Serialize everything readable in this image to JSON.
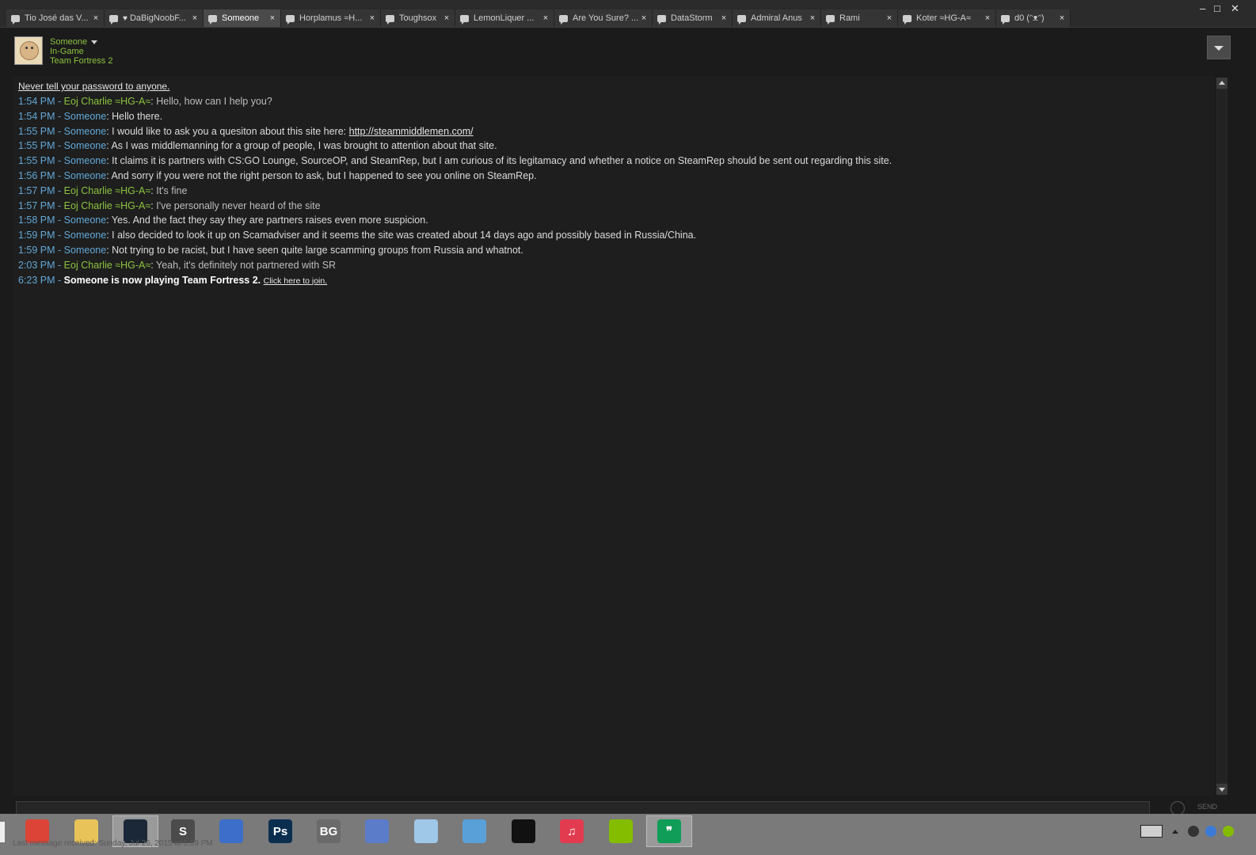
{
  "tabs": [
    {
      "label": "Tio José das V...",
      "heart": false,
      "active": false
    },
    {
      "label": "DaBigNoobF...",
      "heart": true,
      "active": false
    },
    {
      "label": "Someone",
      "heart": false,
      "active": true
    },
    {
      "label": "Horplamus ≈H...",
      "heart": false,
      "active": false
    },
    {
      "label": "Toughsox",
      "heart": false,
      "active": false
    },
    {
      "label": "LemonLiquer ...",
      "heart": false,
      "active": false
    },
    {
      "label": "Are You Sure? ...",
      "heart": false,
      "active": false
    },
    {
      "label": "DataStorm",
      "heart": false,
      "active": false
    },
    {
      "label": "Admiral Anus",
      "heart": false,
      "active": false
    },
    {
      "label": "Rami",
      "heart": false,
      "active": false
    },
    {
      "label": "Koter ≈HG-A≈",
      "heart": false,
      "active": false
    },
    {
      "label": "d0 (ᵔᴥᵔ)",
      "heart": false,
      "active": false
    }
  ],
  "tab_close": "×",
  "window_controls": {
    "minimize": "–",
    "maximize": "□",
    "close": "✕"
  },
  "header": {
    "name": "Someone",
    "status": "In-Game",
    "game": "Team Fortress 2"
  },
  "chat": {
    "warning": "Never tell your password to anyone.",
    "messages": [
      {
        "time": "1:54 PM",
        "sender": "Eoj Charlie ≈HG-A≈",
        "from_me": false,
        "text": "Hello, how can I help you?"
      },
      {
        "time": "1:54 PM",
        "sender": "Someone",
        "from_me": true,
        "text": "Hello there."
      },
      {
        "time": "1:55 PM",
        "sender": "Someone",
        "from_me": true,
        "text": "I would like to ask you a quesiton about this site here: ",
        "link": "http://steammiddlemen.com/"
      },
      {
        "time": "1:55 PM",
        "sender": "Someone",
        "from_me": true,
        "text": "As I was middlemanning for a group of people, I was brought to attention about that site."
      },
      {
        "time": "1:55 PM",
        "sender": "Someone",
        "from_me": true,
        "text": "It claims it is partners with CS:GO Lounge, SourceOP, and SteamRep, but I am curious of its legitamacy and whether a notice on SteamRep should be sent out regarding this site."
      },
      {
        "time": "1:56 PM",
        "sender": "Someone",
        "from_me": true,
        "text": "And sorry if you were not the right person to ask, but I happened to see you online on SteamRep."
      },
      {
        "time": "1:57 PM",
        "sender": "Eoj Charlie ≈HG-A≈",
        "from_me": false,
        "text": "It's fine"
      },
      {
        "time": "1:57 PM",
        "sender": "Eoj Charlie ≈HG-A≈",
        "from_me": false,
        "text": "I've personally never heard of the site"
      },
      {
        "time": "1:58 PM",
        "sender": "Someone",
        "from_me": true,
        "text": "Yes. And the fact they say they are partners raises even more suspicion."
      },
      {
        "time": "1:59 PM",
        "sender": "Someone",
        "from_me": true,
        "text": "I also decided to look it up on Scamadviser and it seems the site was created about 14 days ago and possibly based in Russia/China."
      },
      {
        "time": "1:59 PM",
        "sender": "Someone",
        "from_me": true,
        "text": "Not trying to be racist, but I have seen quite large scamming groups from Russia and whatnot."
      },
      {
        "time": "2:03 PM",
        "sender": "Eoj Charlie ≈HG-A≈",
        "from_me": false,
        "text": "Yeah, it's definitely not partnered with SR"
      }
    ],
    "status_event": {
      "time": "6:23 PM",
      "text": "Someone is now playing Team Fortress 2.",
      "join_link": "Click here to join."
    }
  },
  "input": {
    "send_label": "SEND"
  },
  "footer_status": "Last message received: Sunday, Jul 26, 2015 at 1:59 PM",
  "taskbar": {
    "apps": [
      {
        "name": "chrome-icon",
        "active": false,
        "glyph": "",
        "color": "#db4437"
      },
      {
        "name": "file-explorer-icon",
        "active": false,
        "glyph": "",
        "color": "#e8c35a"
      },
      {
        "name": "steam-icon",
        "active": true,
        "glyph": "",
        "color": "#1b2838"
      },
      {
        "name": "sublime-text-icon",
        "active": false,
        "glyph": "S",
        "color": "#4b4b4b"
      },
      {
        "name": "network-manager-icon",
        "active": false,
        "glyph": "",
        "color": "#3d6ec9"
      },
      {
        "name": "photoshop-icon",
        "active": false,
        "glyph": "Ps",
        "color": "#0b2e4f"
      },
      {
        "name": "bg-app-icon",
        "active": false,
        "glyph": "BG",
        "color": "#6a6a6a"
      },
      {
        "name": "computer-app-icon",
        "active": false,
        "glyph": "",
        "color": "#5a7cc9"
      },
      {
        "name": "notepad-icon",
        "active": false,
        "glyph": "",
        "color": "#9fc7e8"
      },
      {
        "name": "control-panel-icon",
        "active": false,
        "glyph": "",
        "color": "#5aa0d8"
      },
      {
        "name": "obs-icon",
        "active": false,
        "glyph": "",
        "color": "#111111"
      },
      {
        "name": "itunes-icon",
        "active": false,
        "glyph": "♫",
        "color": "#e23b4f"
      },
      {
        "name": "spotify-icon",
        "active": false,
        "glyph": "",
        "color": "#84bd00"
      },
      {
        "name": "hangouts-icon",
        "active": true,
        "glyph": "❞",
        "color": "#0f9d58"
      }
    ]
  }
}
